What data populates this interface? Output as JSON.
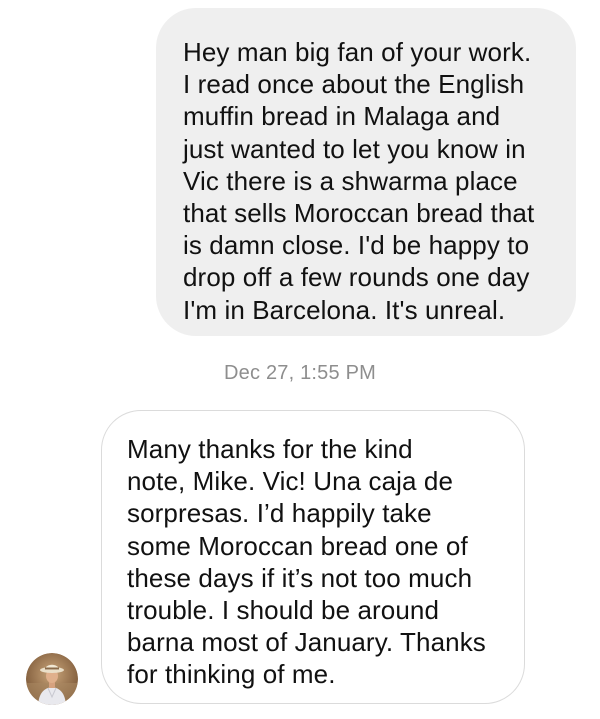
{
  "thread": {
    "incoming_message": "Hey man big fan of your work.\nI read once about the English\nmuffin bread in Malaga and\njust wanted to let you know in\nVic there is a shwarma place\nthat sells Moroccan bread that\nis damn close. I'd be happy to\ndrop off a few rounds one day\nI'm in Barcelona. It's unreal.",
    "timestamp": "Dec 27, 1:55 PM",
    "outgoing_message": "Many thanks for the kind\nnote, Mike. Vic! Una caja de\nsorpresas. I’d happily take\nsome Moroccan bread one of\nthese days if it’s not too much\ntrouble. I should be around\nbarna most of January. Thanks\nfor thinking of me."
  },
  "colors": {
    "incoming_bubble": "#efefef",
    "outgoing_bubble_border": "#dbdbdb",
    "timestamp_text": "#8e8e8e",
    "message_text": "#111111"
  },
  "icons": {
    "avatar": "profile-photo-avatar"
  }
}
